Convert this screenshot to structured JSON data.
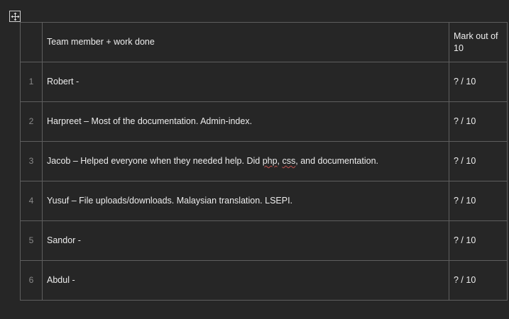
{
  "table": {
    "header": {
      "num": "",
      "work": "Team member + work done",
      "mark": "Mark out of 10"
    },
    "rows": [
      {
        "num": "1",
        "work": "Robert -",
        "mark": "? / 10"
      },
      {
        "num": "2",
        "work": "Harpreet – Most of the documentation. Admin-index.",
        "mark": "? / 10"
      },
      {
        "num": "3",
        "work_parts": [
          "Jacob – Helped everyone when they needed help. Did ",
          "php",
          ", ",
          "css",
          ", and documentation."
        ],
        "mark": "? / 10"
      },
      {
        "num": "4",
        "work": "Yusuf – File uploads/downloads. Malaysian translation. LSEPI.",
        "mark": "? / 10"
      },
      {
        "num": "5",
        "work": "Sandor -",
        "mark": "? / 10"
      },
      {
        "num": "6",
        "work": "Abdul -",
        "mark": "? / 10"
      }
    ]
  },
  "colors": {
    "background": "#262626",
    "border": "#5e5e5e",
    "spellcheck": "#c0504d"
  },
  "icons": {
    "move_handle": "move-arrows-icon"
  }
}
